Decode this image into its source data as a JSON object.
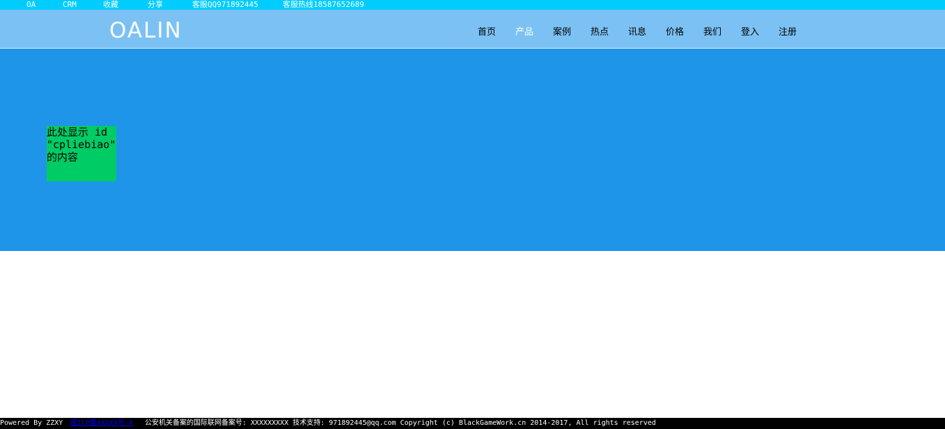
{
  "topbar": {
    "links": [
      "OA",
      "CRM",
      "收藏",
      "分享",
      "客服QQ971892445",
      "客服热线18587652689"
    ]
  },
  "header": {
    "logo": "OALIN",
    "nav": [
      "首页",
      "产品",
      "案例",
      "热点",
      "讯息",
      "价格",
      "我们",
      "登入",
      "注册"
    ],
    "active_nav": "产品"
  },
  "main": {
    "placeholder": "此处显示 id \"cpliebiao\" 的内容"
  },
  "footer": {
    "powered": "Powered By ZZXY",
    "icp_link": "桂ICP备XXXXX号-X",
    "info": "公安机关备案的国际联网备案号: XXXXXXXXX 技术支持: 971892445@qq.com Copyright (c) BlackGameWork.cn 2014-2017, All rights reserved"
  },
  "colors": {
    "topbar": "#00ccff",
    "header": "#7cc1f3",
    "banner": "#1f95ea",
    "content_box": "#00cc66",
    "footer": "#000000"
  }
}
